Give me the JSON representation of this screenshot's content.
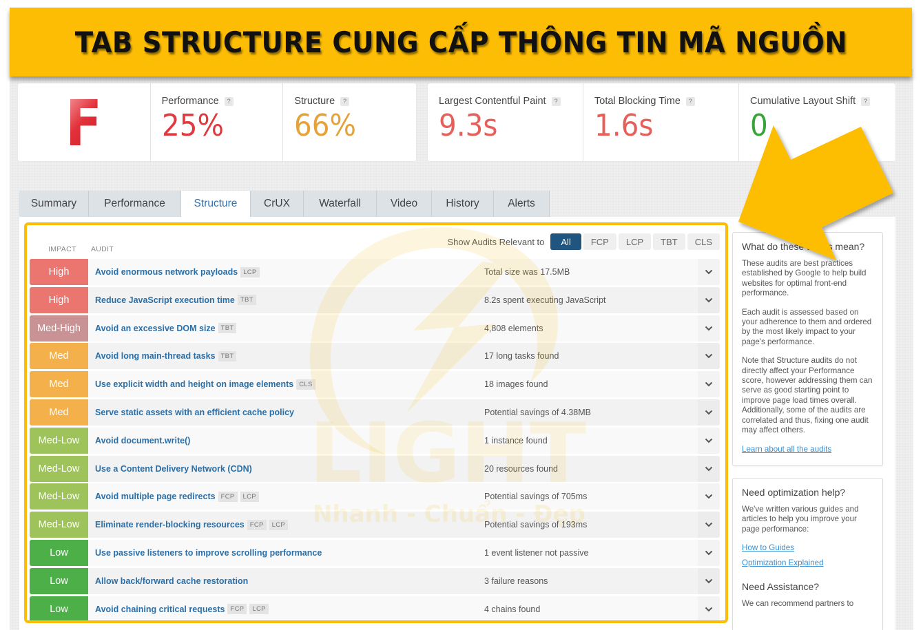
{
  "banner": {
    "title": "TAB STRUCTURE CUNG CẤP THÔNG TIN MÃ NGUỒN",
    "color": "#fdbd05"
  },
  "scores": {
    "grade": "F",
    "help_glyph": "?",
    "metrics": [
      {
        "label": "Performance",
        "value": "25%",
        "color": "#e0393f"
      },
      {
        "label": "Structure",
        "value": "66%",
        "color": "#e6a23a"
      },
      {
        "label": "Largest Contentful Paint",
        "value": "9.3s",
        "color": "#e5605b"
      },
      {
        "label": "Total Blocking Time",
        "value": "1.6s",
        "color": "#e5605b"
      },
      {
        "label": "Cumulative Layout Shift",
        "value": "0",
        "color": "#36a436"
      }
    ]
  },
  "tabs": [
    {
      "label": "Summary",
      "active": false
    },
    {
      "label": "Performance",
      "active": false
    },
    {
      "label": "Structure",
      "active": true
    },
    {
      "label": "CrUX",
      "active": false
    },
    {
      "label": "Waterfall",
      "active": false
    },
    {
      "label": "Video",
      "active": false
    },
    {
      "label": "History",
      "active": false
    },
    {
      "label": "Alerts",
      "active": false
    }
  ],
  "audits": {
    "col_impact": "IMPACT",
    "col_audit": "AUDIT",
    "filter_label": "Show Audits Relevant to",
    "filters": [
      {
        "label": "All",
        "active": true
      },
      {
        "label": "FCP",
        "active": false
      },
      {
        "label": "LCP",
        "active": false
      },
      {
        "label": "TBT",
        "active": false
      },
      {
        "label": "CLS",
        "active": false
      }
    ],
    "impact_colors": {
      "High": "#eb7670",
      "Med-High": "#c99396",
      "Med": "#f4b04a",
      "Med-Low": "#9dc35a",
      "Low": "#4caf48"
    },
    "rows": [
      {
        "impact": "High",
        "title": "Avoid enormous network payloads",
        "tags": [
          "LCP"
        ],
        "result": "Total size was 17.5MB"
      },
      {
        "impact": "High",
        "title": "Reduce JavaScript execution time",
        "tags": [
          "TBT"
        ],
        "result": "8.2s spent executing JavaScript"
      },
      {
        "impact": "Med-High",
        "title": "Avoid an excessive DOM size",
        "tags": [
          "TBT"
        ],
        "result": "4,808 elements"
      },
      {
        "impact": "Med",
        "title": "Avoid long main-thread tasks",
        "tags": [
          "TBT"
        ],
        "result": "17 long tasks found"
      },
      {
        "impact": "Med",
        "title": "Use explicit width and height on image elements",
        "tags": [
          "CLS"
        ],
        "result": "18 images found"
      },
      {
        "impact": "Med",
        "title": "Serve static assets with an efficient cache policy",
        "tags": [],
        "result": "Potential savings of 4.38MB"
      },
      {
        "impact": "Med-Low",
        "title": "Avoid document.write()",
        "tags": [],
        "result": "1 instance found"
      },
      {
        "impact": "Med-Low",
        "title": "Use a Content Delivery Network (CDN)",
        "tags": [],
        "result": "20 resources found"
      },
      {
        "impact": "Med-Low",
        "title": "Avoid multiple page redirects",
        "tags": [
          "FCP",
          "LCP"
        ],
        "result": "Potential savings of 705ms"
      },
      {
        "impact": "Med-Low",
        "title": "Eliminate render-blocking resources",
        "tags": [
          "FCP",
          "LCP"
        ],
        "result": "Potential savings of 193ms"
      },
      {
        "impact": "Low",
        "title": "Use passive listeners to improve scrolling performance",
        "tags": [],
        "result": "1 event listener not passive"
      },
      {
        "impact": "Low",
        "title": "Allow back/forward cache restoration",
        "tags": [],
        "result": "3 failure reasons"
      },
      {
        "impact": "Low",
        "title": "Avoid chaining critical requests",
        "tags": [
          "FCP",
          "LCP"
        ],
        "result": "4 chains found"
      }
    ]
  },
  "sidebar": {
    "box1": {
      "title": "What do these audits mean?",
      "paragraphs": [
        "These audits are best practices established by Google to help build websites for optimal front-end performance.",
        "Each audit is assessed based on your adherence to them and ordered by the most likely impact to your page's performance.",
        "Note that Structure audits do not directly affect your Performance score, however addressing them can serve as good starting point to improve page load times overall. Additionally, some of the audits are correlated and thus, fixing one audit may affect others."
      ],
      "link": "Learn about all the audits"
    },
    "box2": {
      "title": "Need optimization help?",
      "text": "We've written various guides and articles to help you improve your page performance:",
      "links": [
        "How to Guides",
        "Optimization Explained"
      ],
      "title2": "Need Assistance?",
      "text2": "We can recommend partners to"
    }
  },
  "watermark": {
    "brand": "LIGHT",
    "slogan": "Nhanh - Chuẩn - Đẹp"
  }
}
